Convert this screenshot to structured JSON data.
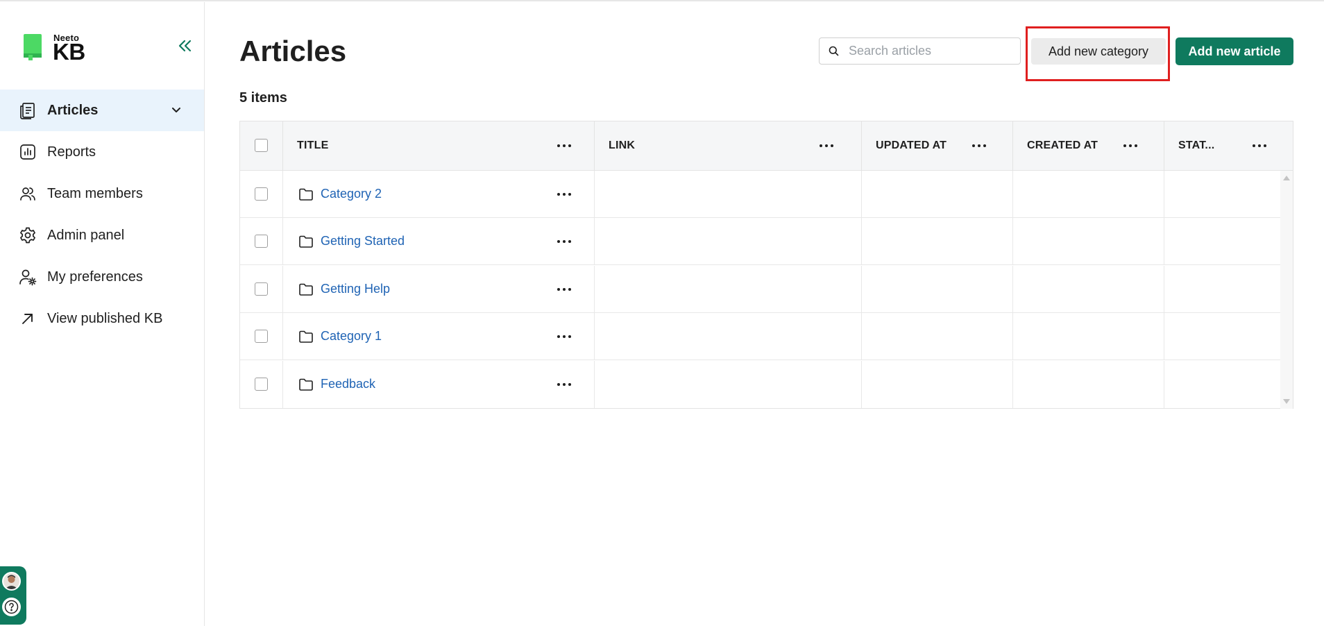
{
  "sidebar": {
    "logo_small": "Neeto",
    "logo_big": "KB",
    "items": [
      {
        "label": "Articles",
        "icon": "articles-icon"
      },
      {
        "label": "Reports",
        "icon": "reports-icon"
      },
      {
        "label": "Team members",
        "icon": "team-icon"
      },
      {
        "label": "Admin panel",
        "icon": "gear-icon"
      },
      {
        "label": "My preferences",
        "icon": "user-settings-icon"
      },
      {
        "label": "View published KB",
        "icon": "external-link-icon"
      }
    ]
  },
  "header": {
    "title": "Articles",
    "search_placeholder": "Search articles",
    "add_category_label": "Add new category",
    "add_article_label": "Add new article"
  },
  "items_count": "5 items",
  "table": {
    "columns": [
      "TITLE",
      "LINK",
      "UPDATED AT",
      "CREATED AT",
      "STAT..."
    ],
    "rows": [
      {
        "title": "Category 2"
      },
      {
        "title": "Getting Started"
      },
      {
        "title": "Getting Help"
      },
      {
        "title": "Category 1"
      },
      {
        "title": "Feedback"
      }
    ]
  },
  "colors": {
    "brand_green": "#0f7a5e",
    "link_blue": "#1f63b4",
    "active_nav_bg": "#e9f3fc",
    "highlight_red": "#e01f1f"
  }
}
